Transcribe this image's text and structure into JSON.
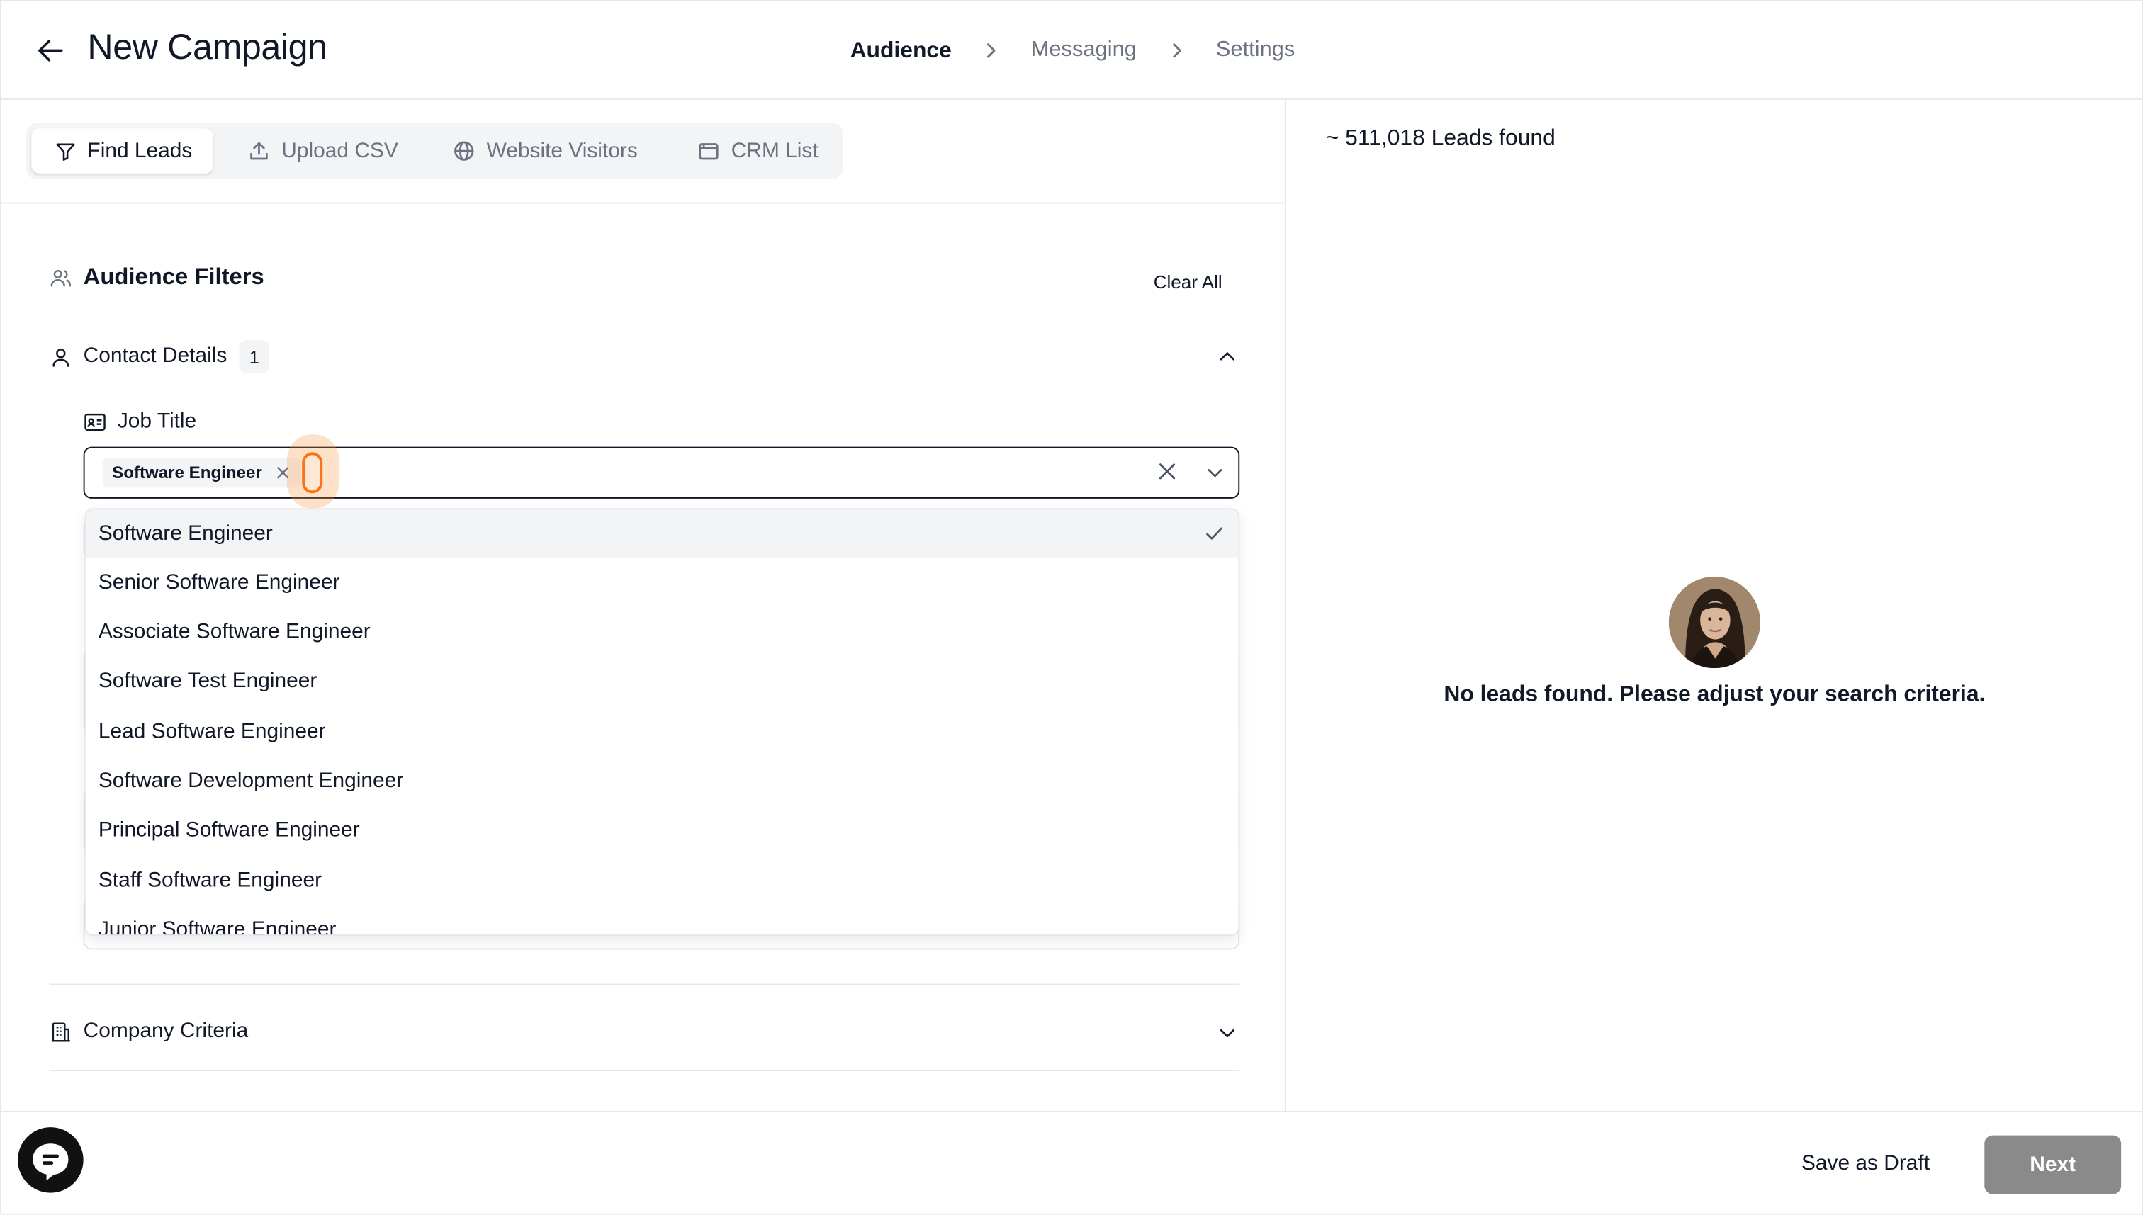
{
  "header": {
    "title": "New Campaign",
    "steps": [
      {
        "label": "Audience",
        "active": true
      },
      {
        "label": "Messaging",
        "active": false
      },
      {
        "label": "Settings",
        "active": false
      }
    ]
  },
  "tabs": [
    {
      "label": "Find Leads",
      "icon": "filter-icon",
      "active": true
    },
    {
      "label": "Upload CSV",
      "icon": "upload-icon",
      "active": false
    },
    {
      "label": "Website Visitors",
      "icon": "globe-icon",
      "active": false
    },
    {
      "label": "CRM List",
      "icon": "crm-list-icon",
      "active": false
    }
  ],
  "filters": {
    "title": "Audience Filters",
    "clear_all": "Clear All",
    "contact_details": {
      "title": "Contact Details",
      "count": "1",
      "job_title": {
        "label": "Job Title",
        "selected": [
          "Software Engineer"
        ],
        "options": [
          {
            "label": "Software Engineer",
            "selected": true
          },
          {
            "label": "Senior Software Engineer",
            "selected": false
          },
          {
            "label": "Associate Software Engineer",
            "selected": false
          },
          {
            "label": "Software Test Engineer",
            "selected": false
          },
          {
            "label": "Lead Software Engineer",
            "selected": false
          },
          {
            "label": "Software Development Engineer",
            "selected": false
          },
          {
            "label": "Principal Software Engineer",
            "selected": false
          },
          {
            "label": "Staff Software Engineer",
            "selected": false
          },
          {
            "label": "Junior Software Engineer",
            "selected": false
          }
        ]
      }
    },
    "company_criteria": {
      "title": "Company Criteria"
    }
  },
  "results": {
    "leads_found": "~ 511,018 Leads found",
    "empty_message": "No leads found. Please adjust your search criteria."
  },
  "footer": {
    "save_draft": "Save as Draft",
    "next": "Next"
  },
  "colors": {
    "accent_cursor": "#f97316",
    "next_disabled": "#8a8a8a",
    "border": "#e5e7eb",
    "text": "#111827",
    "muted": "#6b7280"
  }
}
